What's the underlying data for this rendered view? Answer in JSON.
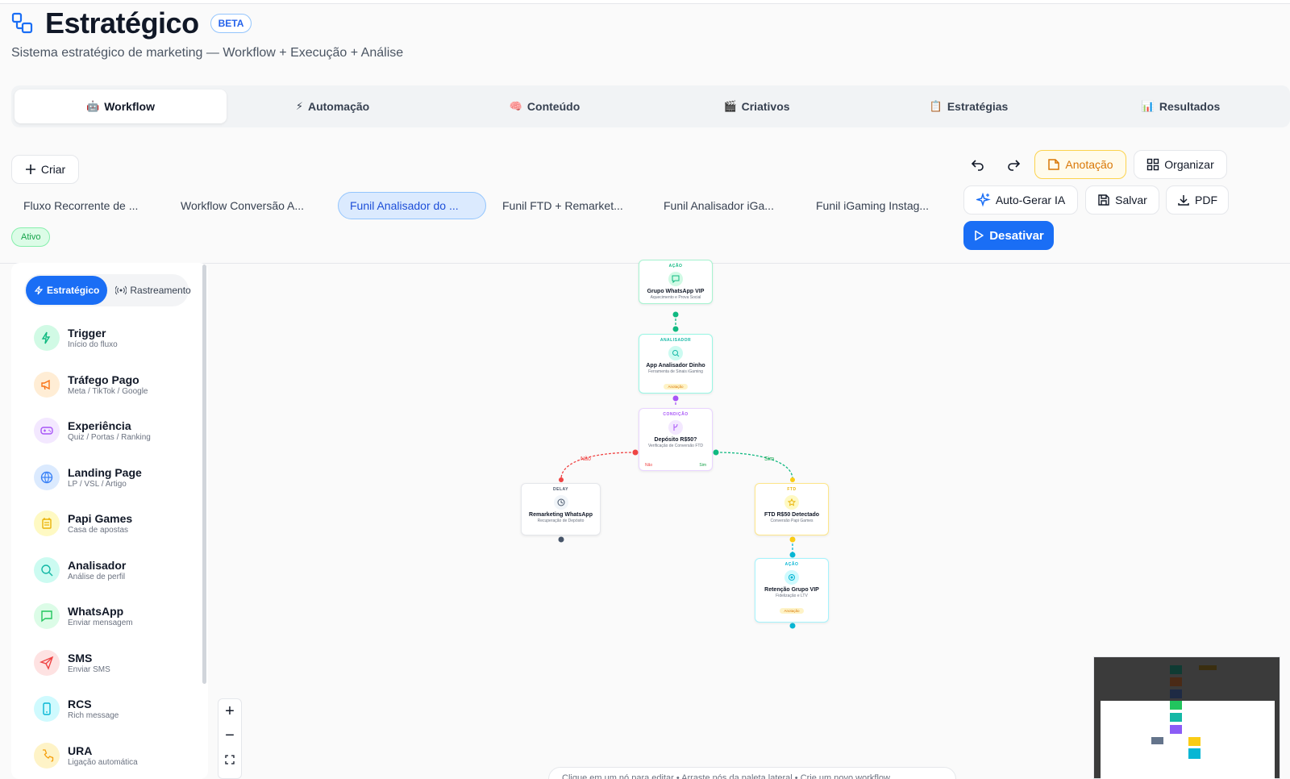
{
  "header": {
    "title": "Estratégico",
    "badge": "BETA",
    "subtitle": "Sistema estratégico de marketing — Workflow + Execução + Análise"
  },
  "tabs": [
    {
      "label": "Workflow",
      "icon": "🤖"
    },
    {
      "label": "Automação",
      "icon": "⚡"
    },
    {
      "label": "Conteúdo",
      "icon": "🧠"
    },
    {
      "label": "Criativos",
      "icon": "🎬"
    },
    {
      "label": "Estratégias",
      "icon": "📋"
    },
    {
      "label": "Resultados",
      "icon": "📊"
    }
  ],
  "toolbar": {
    "criar": "Criar",
    "anotacao": "Anotação",
    "organizar": "Organizar",
    "auto_gerar": "Auto-Gerar IA",
    "salvar": "Salvar",
    "pdf": "PDF",
    "desativar": "Desativar"
  },
  "workflows": [
    "Fluxo Recorrente de ...",
    "Workflow Conversão A...",
    "Funil Analisador do ...",
    "Funil FTD + Remarket...",
    "Funil Analisador iGa...",
    "Funil iGaming Instag..."
  ],
  "status": "Ativo",
  "sidebar": {
    "seg": [
      "Estratégico",
      "Rastreamento"
    ],
    "items": [
      {
        "name": "Trigger",
        "desc": "Início do fluxo"
      },
      {
        "name": "Tráfego Pago",
        "desc": "Meta / TikTok / Google"
      },
      {
        "name": "Experiência",
        "desc": "Quiz / Portas / Ranking"
      },
      {
        "name": "Landing Page",
        "desc": "LP / VSL / Artigo"
      },
      {
        "name": "Papi Games",
        "desc": "Casa de apostas"
      },
      {
        "name": "Analisador",
        "desc": "Análise de perfil"
      },
      {
        "name": "WhatsApp",
        "desc": "Enviar mensagem"
      },
      {
        "name": "SMS",
        "desc": "Enviar SMS"
      },
      {
        "name": "RCS",
        "desc": "Rich message"
      },
      {
        "name": "URA",
        "desc": "Ligação automática"
      }
    ],
    "colors": [
      "#10b981",
      "#f97316",
      "#a855f7",
      "#3b82f6",
      "#eab308",
      "#14b8a6",
      "#22c55e",
      "#ef4444",
      "#06b6d4",
      "#f59e0b"
    ]
  },
  "nodes": {
    "n1": {
      "cat": "AÇÃO",
      "title": "Grupo WhatsApp VIP",
      "desc": "Aquecimento e Prova Social"
    },
    "n2": {
      "cat": "ANALISADOR",
      "title": "App Analisador Dinho",
      "desc": "Ferramenta de Sinais iGaming",
      "tag": "Anotação"
    },
    "n3": {
      "cat": "CONDIÇÃO",
      "title": "Depósito R$50?",
      "desc": "Verificação de Conversão FTD",
      "left": "Não",
      "right": "Sim"
    },
    "n4": {
      "cat": "DELAY",
      "title": "Remarketing WhatsApp",
      "desc": "Recuperação de Depósito"
    },
    "n5": {
      "cat": "FTD",
      "title": "FTD R$50 Detectado",
      "desc": "Conversão Papi Games"
    },
    "n6": {
      "cat": "AÇÃO",
      "title": "Retenção Grupo VIP",
      "desc": "Fidelização e LTV",
      "tag": "Anotação"
    }
  },
  "edges": {
    "no_label": "Não",
    "yes_label": "Sim"
  },
  "hint": "Clique em um nó para editar • Arraste nós da paleta lateral • Crie um novo workflow"
}
